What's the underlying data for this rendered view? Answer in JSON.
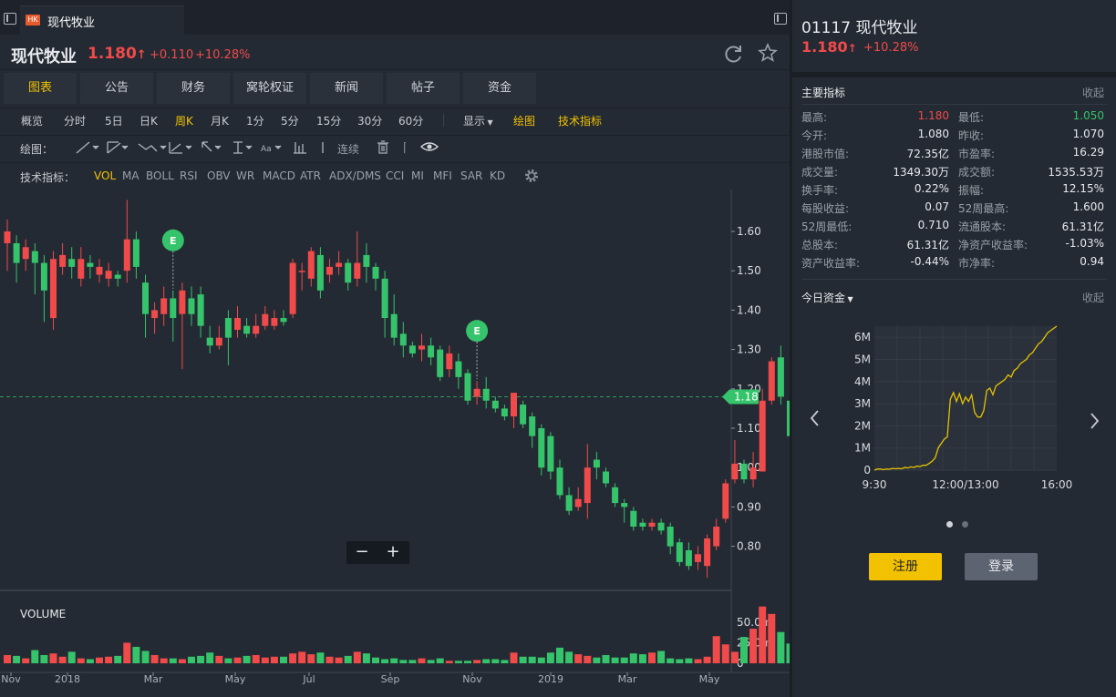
{
  "tab": {
    "badge": "HK",
    "title": "现代牧业"
  },
  "header": {
    "name": "现代牧业",
    "price": "1.180",
    "arrow": "↑",
    "change": "+0.110",
    "pct": "+10.28%"
  },
  "nav_tabs": [
    "图表",
    "公告",
    "财务",
    "窝轮权证",
    "新闻",
    "帖子",
    "资金"
  ],
  "timeframes": [
    "概览",
    "分时",
    "5日",
    "日K",
    "周K",
    "月K",
    "1分",
    "5分",
    "15分",
    "30分",
    "60分"
  ],
  "timeframe_active": "周K",
  "toolbar": {
    "display": "显示",
    "draw": "绘图",
    "tech": "技术指标"
  },
  "draw_row": {
    "label": "绘图：",
    "continuous": "连续"
  },
  "indicator_row": {
    "label": "技术指标：",
    "items": [
      "VOL",
      "MA",
      "BOLL",
      "RSI",
      "OBV",
      "WR",
      "MACD",
      "ATR",
      "ADX/DMS",
      "CCI",
      "MI",
      "MFI",
      "SAR",
      "KD"
    ],
    "active": "VOL"
  },
  "chart": {
    "current_price_label": "1.18",
    "event_marker": "E",
    "zoom_out": "−",
    "zoom_in": "+",
    "volume_label": "VOLUME"
  },
  "chart_data": [
    {
      "type": "candlestick",
      "title": "",
      "y_ticks": [
        "1.60",
        "1.50",
        "1.40",
        "1.30",
        "1.20",
        "1.10",
        "1.00",
        "0.90",
        "0.80"
      ],
      "ylim": [
        0.715,
        1.68
      ],
      "x_ticks": [
        "Nov",
        "2018",
        "Mar",
        "May",
        "Jul",
        "Sep",
        "Nov",
        "2019",
        "Mar",
        "May"
      ],
      "current_price": 1.18,
      "colors": {
        "up": "#f04a4a",
        "down": "#35c46b"
      },
      "candles": [
        [
          1.57,
          1.6,
          1.5,
          1.63
        ],
        [
          1.57,
          1.52,
          1.47,
          1.59
        ],
        [
          1.53,
          1.56,
          1.5,
          1.58
        ],
        [
          1.55,
          1.52,
          1.44,
          1.57
        ],
        [
          1.52,
          1.45,
          1.37,
          1.54
        ],
        [
          1.38,
          1.53,
          1.35,
          1.55
        ],
        [
          1.51,
          1.54,
          1.49,
          1.57
        ],
        [
          1.53,
          1.51,
          1.48,
          1.56
        ],
        [
          1.48,
          1.53,
          1.46,
          1.56
        ],
        [
          1.52,
          1.51,
          1.48,
          1.54
        ],
        [
          1.49,
          1.51,
          1.47,
          1.53
        ],
        [
          1.48,
          1.5,
          1.46,
          1.52
        ],
        [
          1.49,
          1.48,
          1.46,
          1.5
        ],
        [
          1.5,
          1.58,
          1.47,
          1.68
        ],
        [
          1.58,
          1.51,
          1.48,
          1.6
        ],
        [
          1.47,
          1.39,
          1.33,
          1.49
        ],
        [
          1.38,
          1.4,
          1.34,
          1.42
        ],
        [
          1.39,
          1.43,
          1.36,
          1.46
        ],
        [
          1.43,
          1.38,
          1.32,
          1.45
        ],
        [
          1.39,
          1.45,
          1.25,
          1.47
        ],
        [
          1.43,
          1.39,
          1.36,
          1.46
        ],
        [
          1.44,
          1.36,
          1.33,
          1.46
        ],
        [
          1.33,
          1.31,
          1.29,
          1.36
        ],
        [
          1.31,
          1.33,
          1.3,
          1.36
        ],
        [
          1.38,
          1.33,
          1.26,
          1.4
        ],
        [
          1.35,
          1.38,
          1.33,
          1.41
        ],
        [
          1.36,
          1.34,
          1.33,
          1.38
        ],
        [
          1.34,
          1.36,
          1.33,
          1.39
        ],
        [
          1.36,
          1.39,
          1.35,
          1.41
        ],
        [
          1.36,
          1.38,
          1.35,
          1.4
        ],
        [
          1.38,
          1.37,
          1.36,
          1.4
        ],
        [
          1.39,
          1.52,
          1.38,
          1.53
        ],
        [
          1.5,
          1.5,
          1.45,
          1.52
        ],
        [
          1.48,
          1.55,
          1.46,
          1.56
        ],
        [
          1.54,
          1.45,
          1.43,
          1.56
        ],
        [
          1.49,
          1.51,
          1.47,
          1.53
        ],
        [
          1.51,
          1.52,
          1.49,
          1.55
        ],
        [
          1.52,
          1.47,
          1.45,
          1.53
        ],
        [
          1.48,
          1.52,
          1.46,
          1.6
        ],
        [
          1.54,
          1.51,
          1.47,
          1.57
        ],
        [
          1.51,
          1.48,
          1.45,
          1.52
        ],
        [
          1.48,
          1.38,
          1.33,
          1.5
        ],
        [
          1.39,
          1.33,
          1.31,
          1.44
        ],
        [
          1.34,
          1.31,
          1.28,
          1.37
        ],
        [
          1.31,
          1.29,
          1.28,
          1.32
        ],
        [
          1.3,
          1.31,
          1.27,
          1.34
        ],
        [
          1.31,
          1.28,
          1.26,
          1.33
        ],
        [
          1.3,
          1.23,
          1.22,
          1.31
        ],
        [
          1.25,
          1.29,
          1.23,
          1.31
        ],
        [
          1.27,
          1.23,
          1.2,
          1.29
        ],
        [
          1.24,
          1.17,
          1.16,
          1.25
        ],
        [
          1.18,
          1.2,
          1.16,
          1.22
        ],
        [
          1.2,
          1.17,
          1.15,
          1.23
        ],
        [
          1.17,
          1.15,
          1.14,
          1.18
        ],
        [
          1.15,
          1.13,
          1.12,
          1.16
        ],
        [
          1.13,
          1.19,
          1.1,
          1.19
        ],
        [
          1.16,
          1.11,
          1.1,
          1.17
        ],
        [
          1.13,
          1.08,
          1.05,
          1.14
        ],
        [
          1.1,
          1.0,
          0.98,
          1.11
        ],
        [
          1.08,
          0.99,
          0.97,
          1.09
        ],
        [
          1.0,
          0.93,
          0.92,
          1.02
        ],
        [
          0.93,
          0.89,
          0.88,
          0.95
        ],
        [
          0.9,
          0.92,
          0.89,
          0.95
        ],
        [
          0.91,
          1.0,
          0.87,
          1.06
        ],
        [
          1.02,
          1.0,
          0.97,
          1.04
        ],
        [
          0.99,
          0.96,
          0.95,
          1.0
        ],
        [
          0.95,
          0.91,
          0.9,
          0.96
        ],
        [
          0.91,
          0.9,
          0.86,
          0.92
        ],
        [
          0.89,
          0.85,
          0.84,
          0.9
        ],
        [
          0.86,
          0.85,
          0.84,
          0.87
        ],
        [
          0.85,
          0.86,
          0.84,
          0.87
        ],
        [
          0.86,
          0.84,
          0.83,
          0.87
        ],
        [
          0.85,
          0.8,
          0.78,
          0.86
        ],
        [
          0.81,
          0.76,
          0.75,
          0.82
        ],
        [
          0.79,
          0.75,
          0.74,
          0.81
        ],
        [
          0.76,
          0.78,
          0.74,
          0.8
        ],
        [
          0.75,
          0.82,
          0.72,
          0.83
        ],
        [
          0.8,
          0.85,
          0.79,
          0.87
        ],
        [
          0.87,
          0.96,
          0.86,
          0.97
        ],
        [
          0.97,
          1.01,
          0.96,
          1.07
        ],
        [
          1.01,
          0.97,
          0.96,
          1.02
        ],
        [
          0.97,
          1.0,
          0.95,
          1.04
        ],
        [
          0.99,
          1.17,
          0.99,
          1.2
        ],
        [
          1.17,
          1.27,
          1.16,
          1.28
        ],
        [
          1.28,
          1.18,
          1.16,
          1.31
        ],
        [
          1.17,
          1.08,
          1.07,
          1.18
        ],
        [
          1.08,
          1.01,
          0.99,
          1.09
        ],
        [
          1.02,
          1.18,
          1.01,
          1.2
        ]
      ],
      "events_at_index": [
        18,
        51
      ]
    },
    {
      "type": "bar",
      "title": "VOLUME",
      "y_ticks": [
        "50.0m",
        "25.0m",
        "0"
      ],
      "ylim": [
        0,
        72
      ],
      "values": [
        10,
        9,
        6,
        16,
        10,
        12,
        8,
        14,
        6,
        5,
        7,
        8,
        9,
        25,
        20,
        15,
        10,
        6,
        6,
        5,
        8,
        9,
        13,
        9,
        6,
        7,
        9,
        10,
        7,
        8,
        8,
        12,
        14,
        11,
        13,
        8,
        7,
        9,
        14,
        12,
        7,
        5,
        6,
        4,
        4,
        6,
        4,
        6,
        3,
        3,
        3,
        4,
        5,
        5,
        4,
        13,
        8,
        8,
        7,
        13,
        19,
        14,
        11,
        9,
        7,
        10,
        7,
        7,
        12,
        11,
        13,
        15,
        6,
        5,
        6,
        5,
        8,
        33,
        23,
        14,
        32,
        42,
        69,
        60,
        38,
        24,
        40,
        24
      ]
    },
    {
      "type": "line",
      "title": "今日资金",
      "y_ticks": [
        "6M",
        "5M",
        "4M",
        "3M",
        "2M",
        "1M",
        "0"
      ],
      "ylim": [
        0,
        6.5
      ],
      "x_ticks": [
        "9:30",
        "12:00/13:00",
        "16:00"
      ],
      "series": [
        {
          "values": [
            0.0,
            0.05,
            0.05,
            0.02,
            0.05,
            0.04,
            0.08,
            0.06,
            0.08,
            0.06,
            0.12,
            0.1,
            0.15,
            0.12,
            0.18,
            0.16,
            0.22,
            0.22,
            0.3,
            0.4,
            0.55,
            1.0,
            1.2,
            1.4,
            1.5,
            3.2,
            3.5,
            3.1,
            3.45,
            3.0,
            3.3,
            3.1,
            3.4,
            2.6,
            2.4,
            2.4,
            2.7,
            3.6,
            3.7,
            3.4,
            3.8,
            3.9,
            4.0,
            4.1,
            4.3,
            4.2,
            4.5,
            4.6,
            4.8,
            4.9,
            5.0,
            5.2,
            5.3,
            5.5,
            5.7,
            5.8,
            6.0,
            6.2,
            6.3,
            6.4,
            6.5
          ]
        }
      ]
    }
  ],
  "sidebar": {
    "code": "01117",
    "name": "现代牧业",
    "price": "1.180",
    "arrow": "↑",
    "pct": "+10.28%",
    "metrics_title": "主要指标",
    "collapse": "收起",
    "metrics": [
      [
        "最高:",
        "1.180",
        "最低:",
        "1.050"
      ],
      [
        "今开:",
        "1.080",
        "昨收:",
        "1.070"
      ],
      [
        "港股市值:",
        "72.35亿",
        "市盈率:",
        "16.29"
      ],
      [
        "成交量:",
        "1349.30万",
        "成交额:",
        "1535.53万"
      ],
      [
        "换手率:",
        "0.22%",
        "振幅:",
        "12.15%"
      ],
      [
        "每股收益:",
        "0.07",
        "52周最高:",
        "1.600"
      ],
      [
        "52周最低:",
        "0.710",
        "流通股本:",
        "61.31亿"
      ],
      [
        "总股本:",
        "61.31亿",
        "净资产收益率:",
        "-1.03%"
      ],
      [
        "资产收益率:",
        "-0.44%",
        "市净率:",
        "0.94"
      ]
    ],
    "flow_title": "今日资金",
    "flow_collapse": "收起",
    "register": "注册",
    "login": "登录",
    "colors": {
      "accent_red": "#f04a4a",
      "accent_green": "#35c46b",
      "gold": "#f2c200"
    }
  }
}
